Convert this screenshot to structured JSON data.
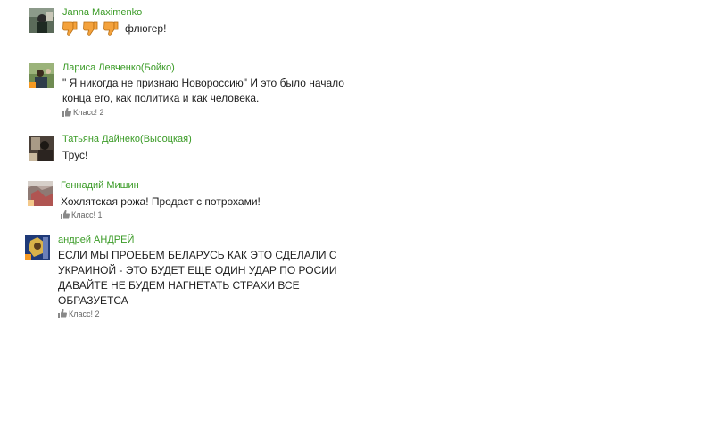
{
  "comments": [
    {
      "author": "Janna Maximenko",
      "text": "флюгер!",
      "reaction_icons": [
        "thumbs-down-icon",
        "thumbs-down-icon",
        "thumbs-down-icon"
      ]
    },
    {
      "author": "Лариса Левченко(Бойко)",
      "text_lines": [
        "\" Я никогда не признаю Новороссию\"   И это было начало",
        "конца его, как политика и как человека."
      ],
      "likes": "Класс! 2"
    },
    {
      "author": "Татьяна Дайнеко(Высоцкая)",
      "text": "Трус!"
    },
    {
      "author": "Геннадий Мишин",
      "text": "Хохлятская рожа! Продаст с потрохами!",
      "likes": "Класс! 1"
    },
    {
      "author": "андрей АНДРЕЙ",
      "text_lines": [
        "ЕСЛИ МЫ ПРОЕБЕМ  БЕЛАРУСЬ КАК ЭТО СДЕЛАЛИ С",
        "УКРАИНОЙ - ЭТО БУДЕТ ЕЩЕ ОДИН УДАР ПО РОСИИ",
        "ДАВАЙТЕ НЕ БУДЕМ НАГНЕТАТЬ  СТРАХИ ВСЕ",
        "ОБРАЗУЕТСА"
      ],
      "likes": "Класс! 2"
    }
  ],
  "colors": {
    "author": "#3a9b26",
    "text": "#1e1e1e",
    "badge": "#f59a23",
    "thumb": "#f4a23c"
  }
}
